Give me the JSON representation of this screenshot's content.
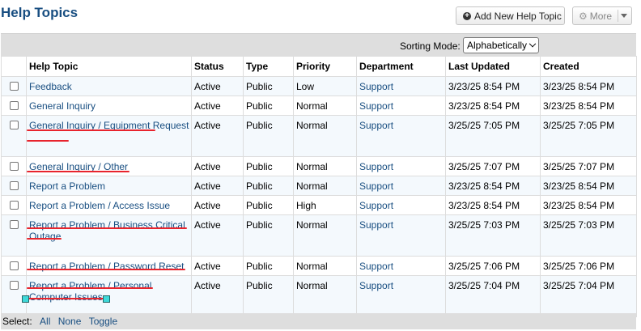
{
  "header": {
    "title": "Help Topics",
    "add_button": "Add New Help Topic",
    "more_button": "More"
  },
  "toolbar": {
    "sort_label": "Sorting Mode:",
    "sort_value": "Alphabetically"
  },
  "table": {
    "columns": [
      "Help Topic",
      "Status",
      "Type",
      "Priority",
      "Department",
      "Last Updated",
      "Created"
    ],
    "rows": [
      {
        "topic": "Feedback",
        "status": "Active",
        "type": "Public",
        "priority": "Low",
        "department": "Support",
        "updated": "3/23/25 8:54 PM",
        "created": "3/23/25 8:54 PM"
      },
      {
        "topic": "General Inquiry",
        "status": "Active",
        "type": "Public",
        "priority": "Normal",
        "department": "Support",
        "updated": "3/23/25 8:54 PM",
        "created": "3/23/25 8:54 PM"
      },
      {
        "topic": "General Inquiry / Equipment Request",
        "status": "Active",
        "type": "Public",
        "priority": "Normal",
        "department": "Support",
        "updated": "3/25/25 7:05 PM",
        "created": "3/25/25 7:05 PM"
      },
      {
        "topic": "General Inquiry / Other",
        "status": "Active",
        "type": "Public",
        "priority": "Normal",
        "department": "Support",
        "updated": "3/25/25 7:07 PM",
        "created": "3/25/25 7:07 PM"
      },
      {
        "topic": "Report a Problem",
        "status": "Active",
        "type": "Public",
        "priority": "Normal",
        "department": "Support",
        "updated": "3/23/25 8:54 PM",
        "created": "3/23/25 8:54 PM"
      },
      {
        "topic": "Report a Problem / Access Issue",
        "status": "Active",
        "type": "Public",
        "priority": "High",
        "department": "Support",
        "updated": "3/23/25 8:54 PM",
        "created": "3/23/25 8:54 PM"
      },
      {
        "topic": "Report a Problem / Business Critical Outage",
        "status": "Active",
        "type": "Public",
        "priority": "Normal",
        "department": "Support",
        "updated": "3/25/25 7:03 PM",
        "created": "3/25/25 7:03 PM"
      },
      {
        "topic": "Report a Problem / Password Reset",
        "status": "Active",
        "type": "Public",
        "priority": "Normal",
        "department": "Support",
        "updated": "3/25/25 7:06 PM",
        "created": "3/25/25 7:06 PM"
      },
      {
        "topic": "Report a Problem / Personal Computer Issues",
        "status": "Active",
        "type": "Public",
        "priority": "Normal",
        "department": "Support",
        "updated": "3/25/25 7:04 PM",
        "created": "3/25/25 7:04 PM"
      }
    ]
  },
  "footer": {
    "select_label": "Select:",
    "all": "All",
    "none": "None",
    "toggle": "Toggle"
  },
  "colors": {
    "link": "#184e81",
    "annotation_underline": "#e8242d",
    "row_alt": "#f4f9fd",
    "toolbar_bg": "#dedede"
  }
}
